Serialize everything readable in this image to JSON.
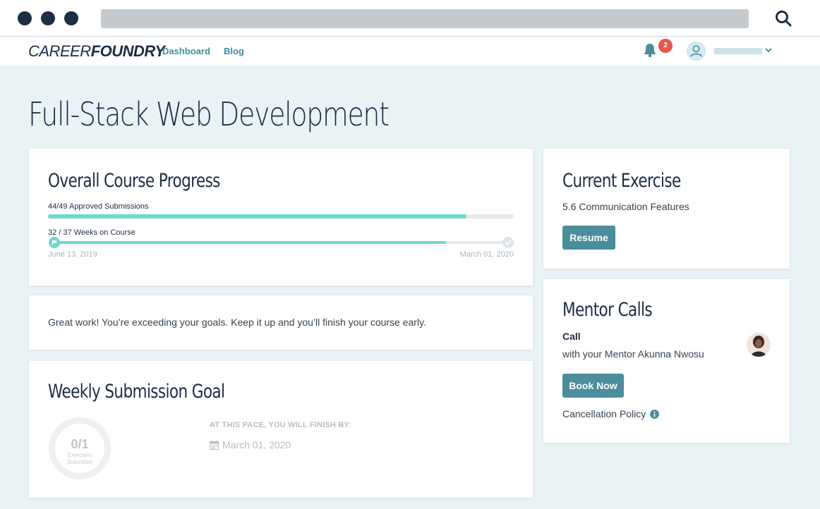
{
  "nav": {
    "logo_light": "CAREER",
    "logo_bold": "FOUNDRY",
    "dashboard": "Dashboard",
    "blog": "Blog",
    "notification_count": "2"
  },
  "page": {
    "title": "Full-Stack Web Development"
  },
  "progress": {
    "title": "Overall Course Progress",
    "submissions_label": "44/49 Approved Submissions",
    "submissions_fraction": 0.898,
    "weeks_label": "32 / 37 Weeks on Course",
    "weeks_fraction": 0.865,
    "start_date": "June 13, 2019",
    "end_date": "March 01, 2020"
  },
  "message": {
    "text": "Great work! You’re exceeding your goals. Keep it up and you’ll finish your course early."
  },
  "weekly": {
    "title": "Weekly Submission Goal",
    "count": "0/1",
    "sub1": "Exercises",
    "sub2": "Submitted",
    "pace_label": "AT THIS PACE, YOU WILL FINISH BY:",
    "pace_date": "March 01, 2020"
  },
  "exercise": {
    "title": "Current Exercise",
    "name": "5.6 Communication Features",
    "button": "Resume"
  },
  "mentor": {
    "title": "Mentor Calls",
    "call_label": "Call",
    "with_text": "with your Mentor Akunna Nwosu",
    "button": "Book Now",
    "policy": "Cancellation Policy"
  },
  "colors": {
    "accent": "#4b8d9b",
    "progress": "#6ed8d0",
    "navy": "#1d2e44",
    "badge": "#e8554a"
  }
}
